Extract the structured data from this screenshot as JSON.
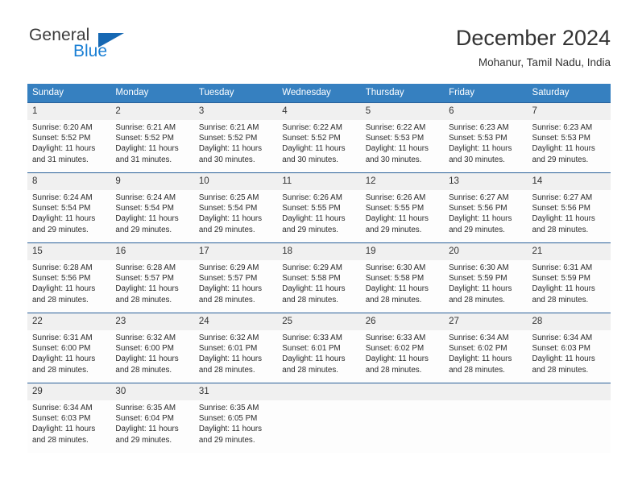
{
  "brand": {
    "name_top": "General",
    "name_bottom": "Blue",
    "triangle_color": "#1668b3",
    "blue_text_color": "#1a7fd4"
  },
  "header": {
    "title": "December 2024",
    "subtitle": "Mohanur, Tamil Nadu, India"
  },
  "theme": {
    "header_row_bg": "#3680c0",
    "row_divider": "#2a6099",
    "date_band_bg": "#f0f0f0",
    "text": "#333333"
  },
  "calendar": {
    "weekday_headers": [
      "Sunday",
      "Monday",
      "Tuesday",
      "Wednesday",
      "Thursday",
      "Friday",
      "Saturday"
    ],
    "weeks": [
      [
        {
          "date": "1",
          "sunrise": "Sunrise: 6:20 AM",
          "sunset": "Sunset: 5:52 PM",
          "daylight_1": "Daylight: 11 hours",
          "daylight_2": "and 31 minutes."
        },
        {
          "date": "2",
          "sunrise": "Sunrise: 6:21 AM",
          "sunset": "Sunset: 5:52 PM",
          "daylight_1": "Daylight: 11 hours",
          "daylight_2": "and 31 minutes."
        },
        {
          "date": "3",
          "sunrise": "Sunrise: 6:21 AM",
          "sunset": "Sunset: 5:52 PM",
          "daylight_1": "Daylight: 11 hours",
          "daylight_2": "and 30 minutes."
        },
        {
          "date": "4",
          "sunrise": "Sunrise: 6:22 AM",
          "sunset": "Sunset: 5:52 PM",
          "daylight_1": "Daylight: 11 hours",
          "daylight_2": "and 30 minutes."
        },
        {
          "date": "5",
          "sunrise": "Sunrise: 6:22 AM",
          "sunset": "Sunset: 5:53 PM",
          "daylight_1": "Daylight: 11 hours",
          "daylight_2": "and 30 minutes."
        },
        {
          "date": "6",
          "sunrise": "Sunrise: 6:23 AM",
          "sunset": "Sunset: 5:53 PM",
          "daylight_1": "Daylight: 11 hours",
          "daylight_2": "and 30 minutes."
        },
        {
          "date": "7",
          "sunrise": "Sunrise: 6:23 AM",
          "sunset": "Sunset: 5:53 PM",
          "daylight_1": "Daylight: 11 hours",
          "daylight_2": "and 29 minutes."
        }
      ],
      [
        {
          "date": "8",
          "sunrise": "Sunrise: 6:24 AM",
          "sunset": "Sunset: 5:54 PM",
          "daylight_1": "Daylight: 11 hours",
          "daylight_2": "and 29 minutes."
        },
        {
          "date": "9",
          "sunrise": "Sunrise: 6:24 AM",
          "sunset": "Sunset: 5:54 PM",
          "daylight_1": "Daylight: 11 hours",
          "daylight_2": "and 29 minutes."
        },
        {
          "date": "10",
          "sunrise": "Sunrise: 6:25 AM",
          "sunset": "Sunset: 5:54 PM",
          "daylight_1": "Daylight: 11 hours",
          "daylight_2": "and 29 minutes."
        },
        {
          "date": "11",
          "sunrise": "Sunrise: 6:26 AM",
          "sunset": "Sunset: 5:55 PM",
          "daylight_1": "Daylight: 11 hours",
          "daylight_2": "and 29 minutes."
        },
        {
          "date": "12",
          "sunrise": "Sunrise: 6:26 AM",
          "sunset": "Sunset: 5:55 PM",
          "daylight_1": "Daylight: 11 hours",
          "daylight_2": "and 29 minutes."
        },
        {
          "date": "13",
          "sunrise": "Sunrise: 6:27 AM",
          "sunset": "Sunset: 5:56 PM",
          "daylight_1": "Daylight: 11 hours",
          "daylight_2": "and 29 minutes."
        },
        {
          "date": "14",
          "sunrise": "Sunrise: 6:27 AM",
          "sunset": "Sunset: 5:56 PM",
          "daylight_1": "Daylight: 11 hours",
          "daylight_2": "and 28 minutes."
        }
      ],
      [
        {
          "date": "15",
          "sunrise": "Sunrise: 6:28 AM",
          "sunset": "Sunset: 5:56 PM",
          "daylight_1": "Daylight: 11 hours",
          "daylight_2": "and 28 minutes."
        },
        {
          "date": "16",
          "sunrise": "Sunrise: 6:28 AM",
          "sunset": "Sunset: 5:57 PM",
          "daylight_1": "Daylight: 11 hours",
          "daylight_2": "and 28 minutes."
        },
        {
          "date": "17",
          "sunrise": "Sunrise: 6:29 AM",
          "sunset": "Sunset: 5:57 PM",
          "daylight_1": "Daylight: 11 hours",
          "daylight_2": "and 28 minutes."
        },
        {
          "date": "18",
          "sunrise": "Sunrise: 6:29 AM",
          "sunset": "Sunset: 5:58 PM",
          "daylight_1": "Daylight: 11 hours",
          "daylight_2": "and 28 minutes."
        },
        {
          "date": "19",
          "sunrise": "Sunrise: 6:30 AM",
          "sunset": "Sunset: 5:58 PM",
          "daylight_1": "Daylight: 11 hours",
          "daylight_2": "and 28 minutes."
        },
        {
          "date": "20",
          "sunrise": "Sunrise: 6:30 AM",
          "sunset": "Sunset: 5:59 PM",
          "daylight_1": "Daylight: 11 hours",
          "daylight_2": "and 28 minutes."
        },
        {
          "date": "21",
          "sunrise": "Sunrise: 6:31 AM",
          "sunset": "Sunset: 5:59 PM",
          "daylight_1": "Daylight: 11 hours",
          "daylight_2": "and 28 minutes."
        }
      ],
      [
        {
          "date": "22",
          "sunrise": "Sunrise: 6:31 AM",
          "sunset": "Sunset: 6:00 PM",
          "daylight_1": "Daylight: 11 hours",
          "daylight_2": "and 28 minutes."
        },
        {
          "date": "23",
          "sunrise": "Sunrise: 6:32 AM",
          "sunset": "Sunset: 6:00 PM",
          "daylight_1": "Daylight: 11 hours",
          "daylight_2": "and 28 minutes."
        },
        {
          "date": "24",
          "sunrise": "Sunrise: 6:32 AM",
          "sunset": "Sunset: 6:01 PM",
          "daylight_1": "Daylight: 11 hours",
          "daylight_2": "and 28 minutes."
        },
        {
          "date": "25",
          "sunrise": "Sunrise: 6:33 AM",
          "sunset": "Sunset: 6:01 PM",
          "daylight_1": "Daylight: 11 hours",
          "daylight_2": "and 28 minutes."
        },
        {
          "date": "26",
          "sunrise": "Sunrise: 6:33 AM",
          "sunset": "Sunset: 6:02 PM",
          "daylight_1": "Daylight: 11 hours",
          "daylight_2": "and 28 minutes."
        },
        {
          "date": "27",
          "sunrise": "Sunrise: 6:34 AM",
          "sunset": "Sunset: 6:02 PM",
          "daylight_1": "Daylight: 11 hours",
          "daylight_2": "and 28 minutes."
        },
        {
          "date": "28",
          "sunrise": "Sunrise: 6:34 AM",
          "sunset": "Sunset: 6:03 PM",
          "daylight_1": "Daylight: 11 hours",
          "daylight_2": "and 28 minutes."
        }
      ],
      [
        {
          "date": "29",
          "sunrise": "Sunrise: 6:34 AM",
          "sunset": "Sunset: 6:03 PM",
          "daylight_1": "Daylight: 11 hours",
          "daylight_2": "and 28 minutes."
        },
        {
          "date": "30",
          "sunrise": "Sunrise: 6:35 AM",
          "sunset": "Sunset: 6:04 PM",
          "daylight_1": "Daylight: 11 hours",
          "daylight_2": "and 29 minutes."
        },
        {
          "date": "31",
          "sunrise": "Sunrise: 6:35 AM",
          "sunset": "Sunset: 6:05 PM",
          "daylight_1": "Daylight: 11 hours",
          "daylight_2": "and 29 minutes."
        },
        {
          "date": "",
          "sunrise": "",
          "sunset": "",
          "daylight_1": "",
          "daylight_2": ""
        },
        {
          "date": "",
          "sunrise": "",
          "sunset": "",
          "daylight_1": "",
          "daylight_2": ""
        },
        {
          "date": "",
          "sunrise": "",
          "sunset": "",
          "daylight_1": "",
          "daylight_2": ""
        },
        {
          "date": "",
          "sunrise": "",
          "sunset": "",
          "daylight_1": "",
          "daylight_2": ""
        }
      ]
    ]
  }
}
